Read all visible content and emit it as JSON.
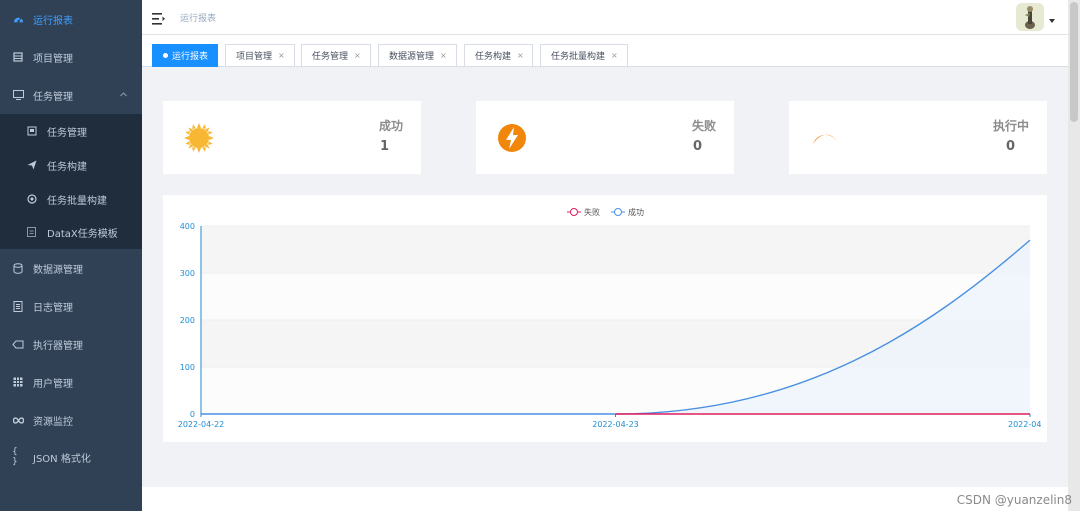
{
  "colors": {
    "sidebar_bg": "#304156",
    "accent": "#1890ff",
    "fail": "#e01e5a",
    "success": "#4a90e2"
  },
  "sidebar": {
    "items": [
      {
        "label": "运行报表",
        "icon": "dashboard-icon",
        "active": true
      },
      {
        "label": "项目管理",
        "icon": "project-icon"
      },
      {
        "label": "任务管理",
        "icon": "monitor-icon",
        "expanded": true
      },
      {
        "label": "数据源管理",
        "icon": "database-icon"
      },
      {
        "label": "日志管理",
        "icon": "log-icon"
      },
      {
        "label": "执行器管理",
        "icon": "executor-icon"
      },
      {
        "label": "用户管理",
        "icon": "table-icon"
      },
      {
        "label": "资源监控",
        "icon": "infinity-icon"
      },
      {
        "label": "JSON 格式化",
        "icon": "braces-icon"
      }
    ],
    "sub_items": [
      {
        "label": "任务管理",
        "icon": "task-icon"
      },
      {
        "label": "任务构建",
        "icon": "send-icon"
      },
      {
        "label": "任务批量构建",
        "icon": "batch-icon"
      },
      {
        "label": "DataX任务模板",
        "icon": "template-icon"
      }
    ]
  },
  "navbar": {
    "breadcrumb": "运行报表"
  },
  "tags": [
    {
      "label": "运行报表",
      "active": true
    },
    {
      "label": "项目管理",
      "close": "×"
    },
    {
      "label": "任务管理",
      "close": "×"
    },
    {
      "label": "数据源管理",
      "close": "×"
    },
    {
      "label": "任务构建",
      "close": "×"
    },
    {
      "label": "任务批量构建",
      "close": "×"
    }
  ],
  "cards": [
    {
      "label": "成功",
      "value": "1",
      "icon": "sun-icon"
    },
    {
      "label": "失败",
      "value": "0",
      "icon": "lightning-icon"
    },
    {
      "label": "执行中",
      "value": "0",
      "icon": "moon-icon"
    }
  ],
  "chart_data": {
    "type": "area",
    "x": [
      "2022-04-22",
      "2022-04-23",
      "2022-04"
    ],
    "ylim": [
      0,
      400
    ],
    "yticks": [
      0,
      100,
      200,
      300,
      400
    ],
    "series": [
      {
        "name": "失败",
        "color": "#e01e5a",
        "values": [
          0,
          0,
          0
        ]
      },
      {
        "name": "成功",
        "color": "#4a90e2",
        "values": [
          0,
          0,
          370
        ]
      }
    ]
  },
  "watermark": "CSDN @yuanzelin8"
}
